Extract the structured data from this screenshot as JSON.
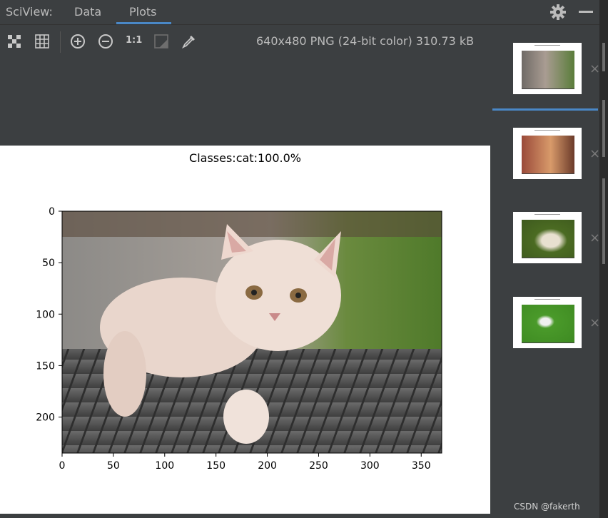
{
  "app": {
    "title": "SciView:"
  },
  "tabs": [
    {
      "label": "Data",
      "active": false
    },
    {
      "label": "Plots",
      "active": true
    }
  ],
  "toolbar": {
    "icons": [
      "fit-icon",
      "grid-icon",
      "zoom-in-icon",
      "zoom-out-icon",
      "actual-size-icon",
      "background-icon",
      "color-picker-icon"
    ],
    "actual_size_label": "1:1",
    "image_info": "640x480 PNG (24-bit color) 310.73 kB"
  },
  "plot": {
    "title": "Classes:cat:100.0%",
    "image_description": "cream kitten walking on wooden planks with green grass background"
  },
  "chart_data": {
    "type": "image",
    "title": "Classes:cat:100.0%",
    "xticks": [
      0,
      50,
      100,
      150,
      200,
      250,
      300,
      350
    ],
    "yticks": [
      0,
      50,
      100,
      150,
      200
    ],
    "xlim": [
      0,
      370
    ],
    "ylim": [
      235,
      0
    ]
  },
  "thumbnails": [
    {
      "name": "thumbnail-cat-1",
      "selected": true,
      "colors": [
        "#6f6a66",
        "#a99c92",
        "#5a7d3a"
      ]
    },
    {
      "name": "thumbnail-cat-2",
      "selected": false,
      "colors": [
        "#9a4a3a",
        "#d89a6a",
        "#6a3a2a"
      ]
    },
    {
      "name": "thumbnail-dog-1",
      "selected": false,
      "colors": [
        "#3e5a1e",
        "#e8e0d0",
        "#4b6b22"
      ]
    },
    {
      "name": "thumbnail-dog-2",
      "selected": false,
      "colors": [
        "#4a9a2a",
        "#f0f0f0",
        "#3e8a22"
      ]
    }
  ],
  "close_glyph": "×",
  "watermark": "CSDN @fakerth",
  "colors": {
    "accent": "#4a88c7",
    "panel": "#3c3f41",
    "text": "#bbbbbb"
  }
}
